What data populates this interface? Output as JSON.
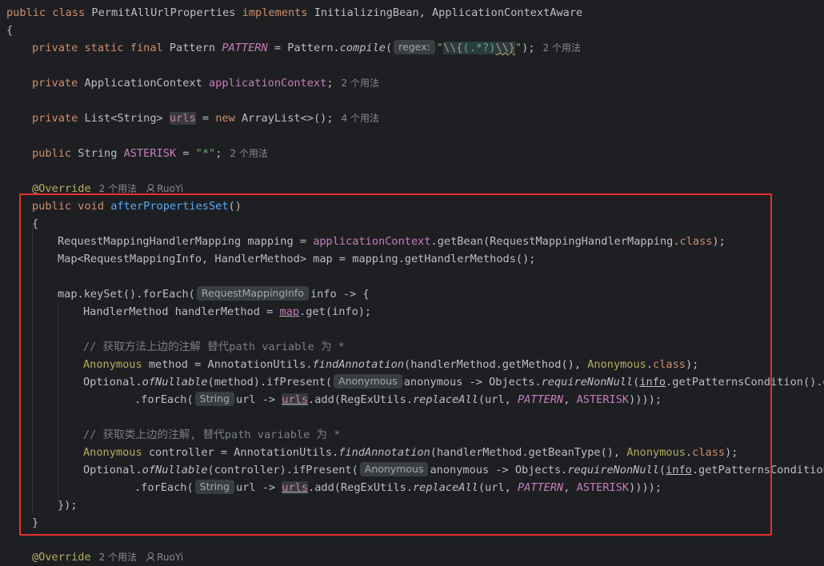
{
  "code": {
    "class_kw": "public class ",
    "class_name": "PermitAllUrlProperties",
    "implements_kw": " implements ",
    "class_rest": "InitializingBean, ApplicationContextAware",
    "open_brace": "{",
    "pattern_prefix": "private static final ",
    "pattern_type": "Pattern ",
    "pattern_name": "PATTERN",
    "pattern_mid": " = Pattern.",
    "pattern_method": "compile",
    "pattern_paren": "(",
    "regex_hint": "regex:",
    "regex_quote_open": "\"",
    "regex_p1": "\\\\{",
    "regex_p2": "(.*?)",
    "regex_p3": "\\\\}",
    "regex_quote_close": "\"",
    "pattern_end": ");",
    "pattern_usage": "2 个用法",
    "ctx_kw": "private ",
    "ctx_type": "ApplicationContext ",
    "ctx_name": "applicationContext",
    "ctx_end": ";",
    "ctx_usage": "2 个用法",
    "urls_kw": "private ",
    "urls_type": "List<String> ",
    "urls_name": "urls",
    "urls_mid": " = ",
    "urls_new": "new ",
    "urls_end": "ArrayList<>();",
    "urls_usage": "4 个用法",
    "ast_kw": "public ",
    "ast_type": "String ",
    "ast_name": "ASTERISK",
    "ast_mid": " = ",
    "ast_val": "\"*\"",
    "ast_end": ";",
    "ast_usage": "2 个用法",
    "override": "@Override",
    "override_usage": "2 个用法",
    "override_author": "RuoYi",
    "method_kw": "public void ",
    "method_name": "afterPropertiesSet",
    "method_end": "()",
    "brace_open": "{",
    "l1_a": "RequestMappingHandlerMapping mapping = ",
    "l1_b": "applicationContext",
    "l1_c": ".getBean(RequestMappingHandlerMapping.",
    "l1_d": "class",
    "l1_e": ");",
    "l2": "Map<RequestMappingInfo, HandlerMethod> map = mapping.getHandlerMethods();",
    "l3_a": "map.keySet().forEach(",
    "l3_hint": "RequestMappingInfo",
    "l3_b": "info -> {",
    "l4_a": "HandlerMethod handlerMethod = ",
    "l4_b": "map",
    "l4_c": ".get(info);",
    "c1": "// 获取方法上边的注解 替代path variable 为 *",
    "l5_a": "Anonymous",
    "l5_b": " method = AnnotationUtils.",
    "l5_c": "findAnnotation",
    "l5_d": "(handlerMethod.getMethod(), ",
    "l5_e": "Anonymous",
    "l5_f": ".",
    "l5_g": "class",
    "l5_h": ");",
    "l6_a": "Optional.",
    "l6_b": "ofNullable",
    "l6_c": "(method).ifPresent(",
    "l6_hint": "Anonymous",
    "l6_d": "anonymous -> Objects.",
    "l6_e": "requireNonNull",
    "l6_f": "(",
    "l6_g": "info",
    "l6_h": ".getPatternsCondition().get",
    "l7_a": ".forEach(",
    "l7_hint": "String",
    "l7_b": "url -> ",
    "l7_c": "urls",
    "l7_d": ".add(RegExUtils.",
    "l7_e": "replaceAll",
    "l7_f": "(url, ",
    "l7_g": "PATTERN",
    "l7_h": ", ",
    "l7_i": "ASTERISK",
    "l7_j": "))));",
    "c2": "// 获取类上边的注解, 替代path variable 为 *",
    "l8_a": "Anonymous",
    "l8_b": " controller = AnnotationUtils.",
    "l8_c": "findAnnotation",
    "l8_d": "(handlerMethod.getBeanType(), ",
    "l8_e": "Anonymous",
    "l8_f": ".",
    "l8_g": "class",
    "l8_h": ");",
    "l9_a": "Optional.",
    "l9_b": "ofNullable",
    "l9_c": "(controller).ifPresent(",
    "l9_hint": "Anonymous",
    "l9_d": "anonymous -> Objects.",
    "l9_e": "requireNonNull",
    "l9_f": "(",
    "l9_g": "info",
    "l9_h": ".getPatternsCondition()",
    "l10_a": ".forEach(",
    "l10_hint": "String",
    "l10_b": "url -> ",
    "l10_c": "urls",
    "l10_d": ".add(RegExUtils.",
    "l10_e": "replaceAll",
    "l10_f": "(url, ",
    "l10_g": "PATTERN",
    "l10_h": ", ",
    "l10_i": "ASTERISK",
    "l10_j": "))));",
    "lambda_close": "});",
    "brace_close": "}",
    "next_override": "@Override",
    "next_usage": "2 个用法",
    "next_author": "RuoYi"
  },
  "colors": {
    "background": "#1e1f22",
    "keyword": "#cf8e6d",
    "field": "#c77dbb",
    "string": "#6aab73",
    "method": "#56a8f5",
    "annotation": "#b3ae60",
    "comment": "#7a7e85",
    "highlight_box": "#e5322d"
  }
}
